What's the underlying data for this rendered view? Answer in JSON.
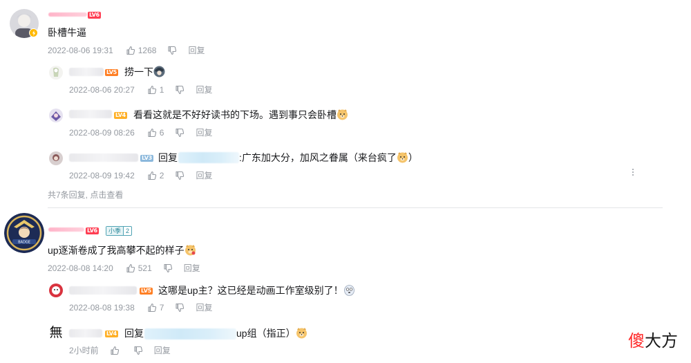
{
  "comments": [
    {
      "level": "LV6",
      "content": "卧槽牛逼",
      "time": "2022-08-06 19:31",
      "likes": "1268",
      "reply_label": "回复",
      "replies": [
        {
          "level": "LV5",
          "content": "捞一下",
          "time": "2022-08-06 20:27",
          "likes": "1",
          "reply_label": "回复"
        },
        {
          "level": "LV4",
          "content": "看看这就是不好好读书的下场。遇到事只会卧槽",
          "time": "2022-08-09 08:26",
          "likes": "6",
          "reply_label": "回复"
        },
        {
          "level": "LV3",
          "reply_prefix": "回复",
          "content": ":广东加大分，加风之眷属（来台疯了",
          "content_tail": "）",
          "time": "2022-08-09 19:42",
          "likes": "2",
          "reply_label": "回复"
        }
      ],
      "more_replies": "共7条回复, 点击查看"
    },
    {
      "level": "LV6",
      "fan_badge": {
        "name": "小季",
        "level": "2"
      },
      "content": "up逐渐卷成了我高攀不起的样子",
      "time": "2022-08-08 14:20",
      "likes": "521",
      "reply_label": "回复",
      "replies": [
        {
          "level": "LV5",
          "content": "这哪是up主？这已经是动画工作室级别了！",
          "time": "2022-08-08 19:38",
          "likes": "7",
          "reply_label": "回复"
        },
        {
          "level": "LV4",
          "avatar_text": "無",
          "reply_prefix": "回复",
          "content": "up组（指正）",
          "time": "2小时前",
          "likes": "",
          "reply_label": "回复"
        }
      ]
    }
  ],
  "watermark": {
    "part1": "傻",
    "part2": "大方"
  },
  "colors": {
    "meta": "#9499a0",
    "text": "#18191c",
    "divider": "#e3e5e7",
    "lv_red": "#ff3d52",
    "lv_orange": "#ff7f24"
  }
}
